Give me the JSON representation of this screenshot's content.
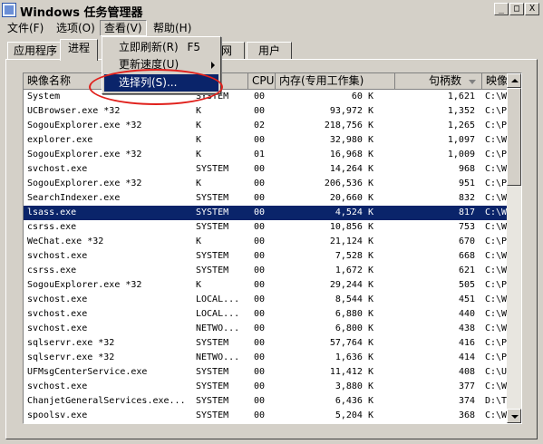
{
  "window": {
    "title": "Windows 任务管理器"
  },
  "title_buttons": {
    "minimize": "_",
    "maximize": "□",
    "close": "X"
  },
  "menubar": [
    {
      "label": "文件(F)"
    },
    {
      "label": "选项(O)"
    },
    {
      "label": "查看(V)"
    },
    {
      "label": "帮助(H)"
    }
  ],
  "tabs": [
    {
      "label": "应用程序"
    },
    {
      "label": "进程"
    },
    {
      "label": "网"
    },
    {
      "label": "用户"
    }
  ],
  "view_menu": {
    "refresh_now": "立即刷新(R)",
    "refresh_shortcut": "F5",
    "update_speed": "更新速度(U)",
    "select_columns": "选择列(S)..."
  },
  "columns": {
    "image_name": "映像名称",
    "user": "名",
    "cpu": "CPU",
    "memory": "内存(专用工作集)",
    "handles": "句柄数",
    "image_path": "映像"
  },
  "processes": [
    {
      "name": "System",
      "user": "SYSTEM",
      "cpu": "00",
      "mem": "60 K",
      "handles": "1,621",
      "path": "C:\\W"
    },
    {
      "name": "UCBrowser.exe *32",
      "user": "K",
      "cpu": "00",
      "mem": "93,972 K",
      "handles": "1,352",
      "path": "C:\\P"
    },
    {
      "name": "SogouExplorer.exe *32",
      "user": "K",
      "cpu": "02",
      "mem": "218,756 K",
      "handles": "1,265",
      "path": "C:\\P"
    },
    {
      "name": "explorer.exe",
      "user": "K",
      "cpu": "00",
      "mem": "32,980 K",
      "handles": "1,097",
      "path": "C:\\W"
    },
    {
      "name": "SogouExplorer.exe *32",
      "user": "K",
      "cpu": "01",
      "mem": "16,968 K",
      "handles": "1,009",
      "path": "C:\\P"
    },
    {
      "name": "svchost.exe",
      "user": "SYSTEM",
      "cpu": "00",
      "mem": "14,264 K",
      "handles": "968",
      "path": "C:\\W"
    },
    {
      "name": "SogouExplorer.exe *32",
      "user": "K",
      "cpu": "00",
      "mem": "206,536 K",
      "handles": "951",
      "path": "C:\\P"
    },
    {
      "name": "SearchIndexer.exe",
      "user": "SYSTEM",
      "cpu": "00",
      "mem": "20,660 K",
      "handles": "832",
      "path": "C:\\W"
    },
    {
      "name": "lsass.exe",
      "user": "SYSTEM",
      "cpu": "00",
      "mem": "4,524 K",
      "handles": "817",
      "path": "C:\\W",
      "selected": true
    },
    {
      "name": "csrss.exe",
      "user": "SYSTEM",
      "cpu": "00",
      "mem": "10,856 K",
      "handles": "753",
      "path": "C:\\W"
    },
    {
      "name": "WeChat.exe *32",
      "user": "K",
      "cpu": "00",
      "mem": "21,124 K",
      "handles": "670",
      "path": "C:\\P"
    },
    {
      "name": "svchost.exe",
      "user": "SYSTEM",
      "cpu": "00",
      "mem": "7,528 K",
      "handles": "668",
      "path": "C:\\W"
    },
    {
      "name": "csrss.exe",
      "user": "SYSTEM",
      "cpu": "00",
      "mem": "1,672 K",
      "handles": "621",
      "path": "C:\\W"
    },
    {
      "name": "SogouExplorer.exe *32",
      "user": "K",
      "cpu": "00",
      "mem": "29,244 K",
      "handles": "505",
      "path": "C:\\P"
    },
    {
      "name": "svchost.exe",
      "user": "LOCAL...",
      "cpu": "00",
      "mem": "8,544 K",
      "handles": "451",
      "path": "C:\\W"
    },
    {
      "name": "svchost.exe",
      "user": "LOCAL...",
      "cpu": "00",
      "mem": "6,880 K",
      "handles": "440",
      "path": "C:\\W"
    },
    {
      "name": "svchost.exe",
      "user": "NETWO...",
      "cpu": "00",
      "mem": "6,800 K",
      "handles": "438",
      "path": "C:\\W"
    },
    {
      "name": "sqlservr.exe *32",
      "user": "SYSTEM",
      "cpu": "00",
      "mem": "57,764 K",
      "handles": "416",
      "path": "C:\\P"
    },
    {
      "name": "sqlservr.exe *32",
      "user": "NETWO...",
      "cpu": "00",
      "mem": "1,636 K",
      "handles": "414",
      "path": "C:\\P"
    },
    {
      "name": "UFMsgCenterService.exe",
      "user": "SYSTEM",
      "cpu": "00",
      "mem": "11,412 K",
      "handles": "408",
      "path": "C:\\U"
    },
    {
      "name": "svchost.exe",
      "user": "SYSTEM",
      "cpu": "00",
      "mem": "3,880 K",
      "handles": "377",
      "path": "C:\\W"
    },
    {
      "name": "ChanjetGeneralServices.exe...",
      "user": "SYSTEM",
      "cpu": "00",
      "mem": "6,436 K",
      "handles": "374",
      "path": "D:\\T"
    },
    {
      "name": "spoolsv.exe",
      "user": "SYSTEM",
      "cpu": "00",
      "mem": "5,204 K",
      "handles": "368",
      "path": "C:\\W"
    }
  ],
  "colors": {
    "window_bg": "#d4d0c8",
    "selection_bg": "#0a246a",
    "annotation_ellipse": "#e0201c"
  }
}
